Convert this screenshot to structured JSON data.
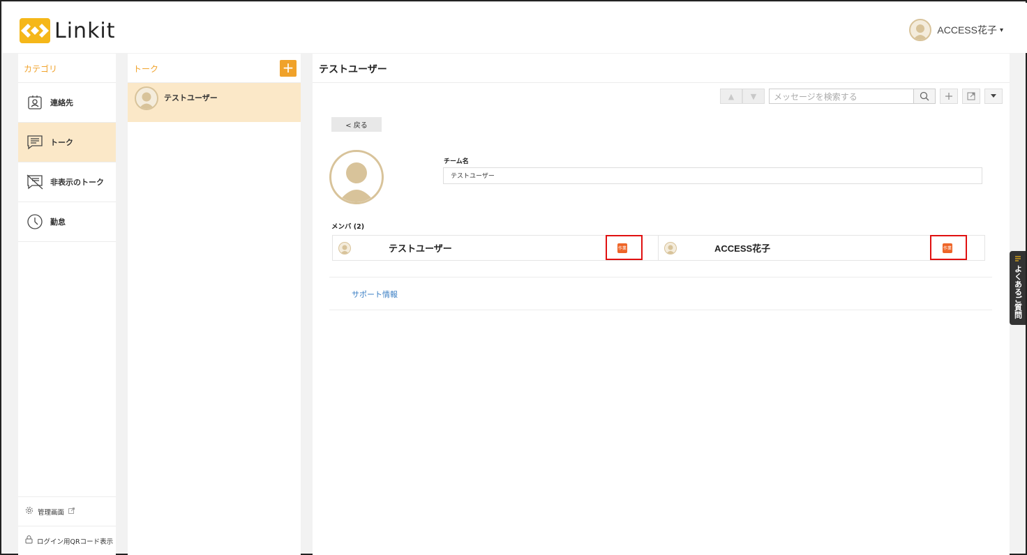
{
  "app": {
    "logo_text": "Linkit",
    "brand_color": "#f0a22a",
    "accent_badge": "#ee6528"
  },
  "account": {
    "name": "ACCESS花子",
    "caret": "▾"
  },
  "category": {
    "header": "カテゴリ",
    "items": [
      {
        "label": "連絡先",
        "icon": "contact-icon"
      },
      {
        "label": "トーク",
        "icon": "chat-icon",
        "active": true
      },
      {
        "label": "非表示のトーク",
        "icon": "hidden-chat-icon"
      },
      {
        "label": "勤怠",
        "icon": "clock-icon"
      }
    ],
    "footer": [
      {
        "label": "管理画面",
        "icon": "gear-icon"
      },
      {
        "label": "ログイン用QRコード表示",
        "icon": "lock-icon"
      }
    ]
  },
  "talk": {
    "header": "トーク",
    "add_label": "+",
    "items": [
      {
        "name": "テストユーザー"
      }
    ]
  },
  "main": {
    "title": "テストユーザー",
    "search_placeholder": "メッセージを検索する",
    "back_label": "< 戻る",
    "team_label": "チーム名",
    "team_value": "テストユーザー",
    "members_label": "メンバ (2)",
    "members": [
      {
        "name": "テストユーザー",
        "badge": "作業"
      },
      {
        "name": "ACCESS花子",
        "badge": "作業"
      }
    ],
    "support_link": "サポート情報"
  },
  "faq": {
    "label": "よくあるご質問"
  }
}
